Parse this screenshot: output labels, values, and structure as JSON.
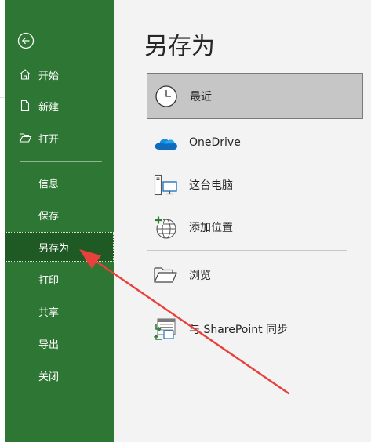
{
  "sidebar": {
    "items": [
      {
        "label": "开始",
        "icon": "home-icon"
      },
      {
        "label": "新建",
        "icon": "new-document-icon"
      },
      {
        "label": "打开",
        "icon": "open-folder-icon"
      },
      {
        "label": "信息"
      },
      {
        "label": "保存"
      },
      {
        "label": "另存为",
        "selected": true
      },
      {
        "label": "打印"
      },
      {
        "label": "共享"
      },
      {
        "label": "导出"
      },
      {
        "label": "关闭"
      }
    ]
  },
  "main": {
    "title": "另存为",
    "locations": [
      {
        "label": "最近",
        "icon": "clock-icon",
        "selected": true
      },
      {
        "label": "OneDrive",
        "icon": "onedrive-cloud-icon"
      },
      {
        "label": "这台电脑",
        "icon": "computer-icon"
      },
      {
        "label": "添加位置",
        "icon": "add-location-globe-icon"
      },
      {
        "label": "浏览",
        "icon": "browse-folder-icon"
      },
      {
        "label": "与 SharePoint 同步",
        "icon": "sharepoint-sync-icon"
      }
    ]
  },
  "colors": {
    "sidebar_bg": "#2e7633",
    "sidebar_selected_bg": "#1f5a24",
    "main_bg": "#f3f3f3",
    "selected_location_bg": "#c6c6c6",
    "annotation_arrow": "#e8413c"
  }
}
